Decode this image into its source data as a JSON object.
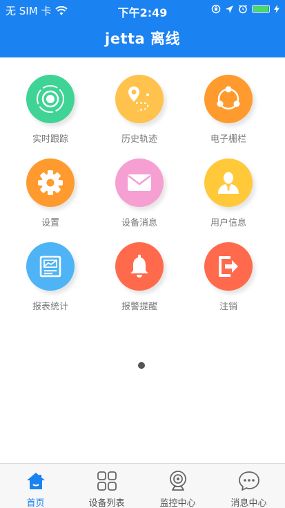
{
  "status_bar": {
    "carrier": "无 SIM 卡",
    "time": "下午2:49"
  },
  "header": {
    "title": "jetta 离线"
  },
  "grid": {
    "items": [
      {
        "label": "实时跟踪",
        "icon": "target-icon",
        "color": "#3fd495"
      },
      {
        "label": "历史轨迹",
        "icon": "route-pin-icon",
        "color": "#ffc24d"
      },
      {
        "label": "电子栅栏",
        "icon": "share-nodes-icon",
        "color": "#ff9b2e"
      },
      {
        "label": "设置",
        "icon": "gear-icon",
        "color": "#ff9b2e"
      },
      {
        "label": "设备消息",
        "icon": "envelope-icon",
        "color": "#f59fd2"
      },
      {
        "label": "用户信息",
        "icon": "user-icon",
        "color": "#ffc93a"
      },
      {
        "label": "报表统计",
        "icon": "chart-report-icon",
        "color": "#4fb4f5"
      },
      {
        "label": "报警提醒",
        "icon": "bell-icon",
        "color": "#ff6a4d"
      },
      {
        "label": "注销",
        "icon": "logout-icon",
        "color": "#ff6a4d"
      }
    ]
  },
  "pager": {
    "pages": 1,
    "current": 1
  },
  "tabbar": {
    "tabs": [
      {
        "label": "首页",
        "icon": "home-icon",
        "active": true
      },
      {
        "label": "设备列表",
        "icon": "grid-icon",
        "active": false
      },
      {
        "label": "监控中心",
        "icon": "camera-icon",
        "active": false
      },
      {
        "label": "消息中心",
        "icon": "chat-icon",
        "active": false
      }
    ]
  },
  "colors": {
    "primary": "#1b82f2",
    "battery": "#4cd964"
  }
}
